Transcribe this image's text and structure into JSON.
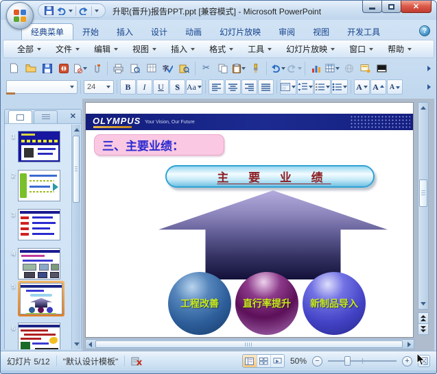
{
  "window": {
    "title": "升职(晋升)报告PPT.ppt [兼容模式] - Microsoft PowerPoint"
  },
  "icons": {
    "close": "✕",
    "help": "?",
    "scissors": "✂",
    "panel_close": "✕"
  },
  "ribbon": {
    "tabs": [
      {
        "label": "经典菜单",
        "active": true
      },
      {
        "label": "开始"
      },
      {
        "label": "插入"
      },
      {
        "label": "设计"
      },
      {
        "label": "动画"
      },
      {
        "label": "幻灯片放映"
      },
      {
        "label": "审阅"
      },
      {
        "label": "视图"
      },
      {
        "label": "开发工具"
      }
    ]
  },
  "menus": {
    "items": [
      {
        "label": "全部"
      },
      {
        "label": "文件"
      },
      {
        "label": "编辑"
      },
      {
        "label": "视图"
      },
      {
        "label": "插入"
      },
      {
        "label": "格式"
      },
      {
        "label": "工具"
      },
      {
        "label": "幻灯片放映"
      },
      {
        "label": "窗口"
      },
      {
        "label": "帮助"
      }
    ]
  },
  "formatting": {
    "font_name": "",
    "font_size": "24",
    "bold": "B",
    "italic": "I",
    "underline": "U",
    "shadow": "S",
    "change_case": "Aa",
    "font_color": "A",
    "increase_font": "A",
    "decrease_font": "A"
  },
  "thumbnails": [
    {
      "number": "1"
    },
    {
      "number": "2"
    },
    {
      "number": "3"
    },
    {
      "number": "4"
    },
    {
      "number": "5",
      "selected": true
    },
    {
      "number": "6"
    }
  ],
  "slide": {
    "logo": "OLYMPUS",
    "tagline": "Your Vision, Our Future",
    "section_title": "三、主要业绩：",
    "banner": "主 要 业 绩",
    "spheres": [
      {
        "label": "工程改善",
        "color": "#2d5d99"
      },
      {
        "label": "直行率提升",
        "color": "#5c1058"
      },
      {
        "label": "新制品导入",
        "color": "#4343c6"
      }
    ],
    "colors": {
      "header_navy": "#1b2585",
      "title_box_pink": "#fac8e2",
      "title_text_blue": "#2b2bd0",
      "banner_text_red": "#8b2024",
      "banner_border_cyan": "#2fa3d4",
      "sphere_text": "#c8ea1c",
      "arrow_top": "#b4acdd",
      "arrow_bottom": "#12113a",
      "selected_thumb_orange": "#e07f28"
    }
  },
  "statusbar": {
    "slide_counter": "幻灯片 5/12",
    "template_name": "\"默认设计模板\"",
    "zoom_level": "50%"
  }
}
